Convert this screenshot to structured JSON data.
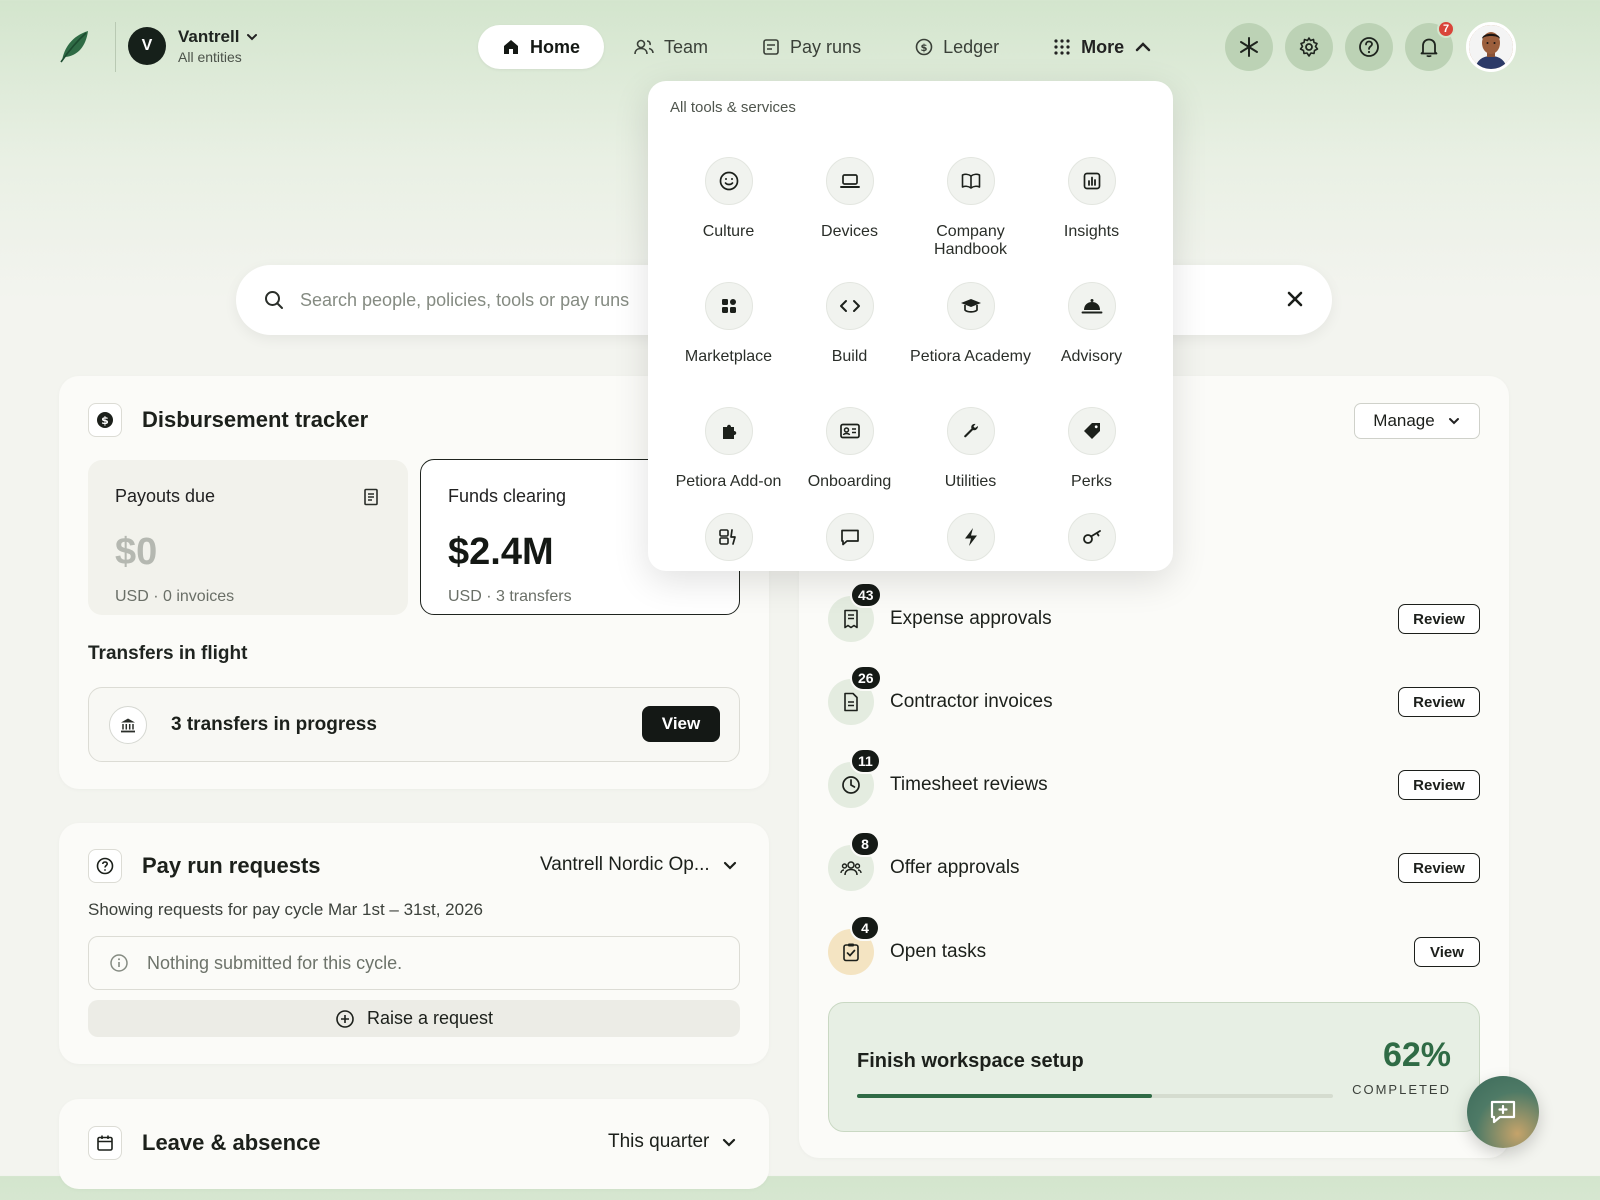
{
  "entity": {
    "initial": "V",
    "name": "Vantrell",
    "sub": "All entities"
  },
  "nav": {
    "home": "Home",
    "team": "Team",
    "pay_runs": "Pay runs",
    "ledger": "Ledger",
    "more": "More"
  },
  "notifications": {
    "count": "7"
  },
  "search": {
    "placeholder": "Search people, policies, tools or pay runs"
  },
  "tools_menu": {
    "heading": "All tools & services",
    "items": [
      {
        "label": "Culture",
        "icon": "smile-icon"
      },
      {
        "label": "Devices",
        "icon": "laptop-icon"
      },
      {
        "label": "Company Handbook",
        "icon": "book-icon"
      },
      {
        "label": "Insights",
        "icon": "chart-icon"
      },
      {
        "label": "Marketplace",
        "icon": "apps-icon"
      },
      {
        "label": "Build",
        "icon": "code-icon"
      },
      {
        "label": "Petiora Academy",
        "icon": "graduation-icon"
      },
      {
        "label": "Advisory",
        "icon": "concierge-icon"
      },
      {
        "label": "Petiora Add-on",
        "icon": "puzzle-icon"
      },
      {
        "label": "Onboarding",
        "icon": "id-card-icon"
      },
      {
        "label": "Utilities",
        "icon": "wrench-icon"
      },
      {
        "label": "Perks",
        "icon": "tag-icon"
      }
    ]
  },
  "disbursement": {
    "title": "Disbursement tracker",
    "payouts_due": {
      "label": "Payouts due",
      "amount": "$0",
      "sub": "USD · 0 invoices"
    },
    "funds_clearing": {
      "label": "Funds clearing",
      "amount": "$2.4M",
      "sub": "USD · 3 transfers"
    },
    "transfers_title": "Transfers in flight",
    "transfers_text": "3 transfers in progress",
    "view_label": "View"
  },
  "pay_run_requests": {
    "title": "Pay run requests",
    "entity_select": "Vantrell Nordic Op...",
    "cycle_text": "Showing requests for pay cycle Mar 1st – 31st, 2026",
    "empty_text": "Nothing submitted for this cycle.",
    "raise_label": "Raise a request"
  },
  "leave": {
    "title": "Leave & absence",
    "period": "This quarter"
  },
  "approvals": {
    "manage_label": "Manage",
    "rows": [
      {
        "label": "Expense approvals",
        "count": "43",
        "action": "Review"
      },
      {
        "label": "Contractor invoices",
        "count": "26",
        "action": "Review"
      },
      {
        "label": "Timesheet reviews",
        "count": "11",
        "action": "Review"
      },
      {
        "label": "Offer approvals",
        "count": "8",
        "action": "Review"
      },
      {
        "label": "Open tasks",
        "count": "4",
        "action": "View"
      }
    ]
  },
  "setup": {
    "title": "Finish workspace setup",
    "percent": "62%",
    "status": "COMPLETED",
    "progress": 0.62
  },
  "colors": {
    "accent": "#2f6b45",
    "brand_bg": "#d3e5cd",
    "badge": "#d9453a"
  }
}
